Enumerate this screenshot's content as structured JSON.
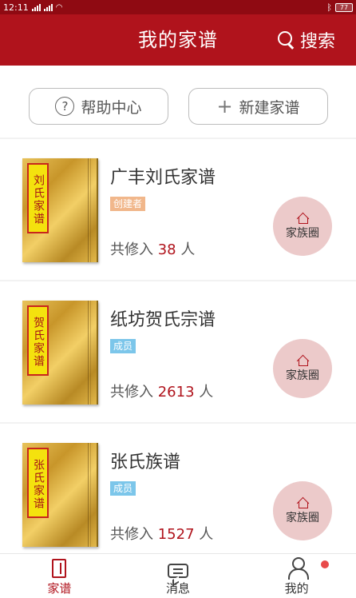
{
  "status_bar": {
    "time": "12:11",
    "battery": "77"
  },
  "header": {
    "title": "我的家谱",
    "search_label": "搜索"
  },
  "actions": {
    "help_label": "帮助中心",
    "create_label": "新建家谱"
  },
  "genealogies": [
    {
      "cover_label": "刘氏家谱",
      "name": "广丰刘氏家谱",
      "role": "创建者",
      "count_prefix": "共修入",
      "count": "38",
      "count_suffix": "人",
      "clan_button": "家族圈"
    },
    {
      "cover_label": "贺氏家谱",
      "name": "纸坊贺氏宗谱",
      "role": "成员",
      "count_prefix": "共修入",
      "count": "2613",
      "count_suffix": "人",
      "clan_button": "家族圈"
    },
    {
      "cover_label": "张氏家谱",
      "name": "张氏族谱",
      "role": "成员",
      "count_prefix": "共修入",
      "count": "1527",
      "count_suffix": "人",
      "clan_button": "家族圈"
    }
  ],
  "tabs": [
    {
      "label": "家谱",
      "icon": "pedigree-icon",
      "active": true
    },
    {
      "label": "消息",
      "icon": "message-icon",
      "active": false
    },
    {
      "label": "我的",
      "icon": "user-icon",
      "active": false,
      "badge": true
    }
  ],
  "colors": {
    "brand_red": "#b0131c",
    "creator_badge": "#f1b78b",
    "member_badge": "#7cc6ea",
    "clan_button_bg": "#eccaca"
  }
}
